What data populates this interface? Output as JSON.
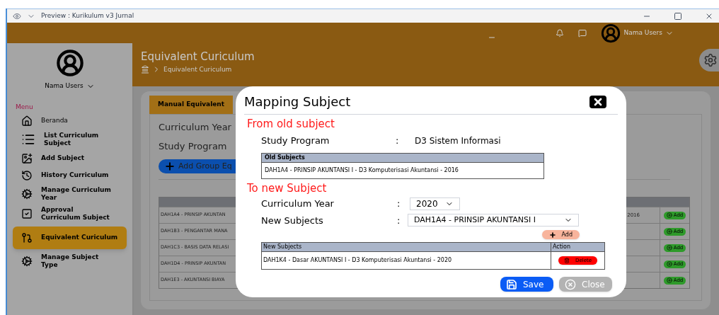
{
  "window": {
    "title": "Preview : Kurikulum v3 Jurnal"
  },
  "topbar": {
    "user_name": "Nama Users"
  },
  "sidebar": {
    "user_name": "Nama Users",
    "menu_label": "Menu",
    "items": [
      {
        "label": "Beranda",
        "selected": false
      },
      {
        "label": "List Curriculum Subject",
        "selected": false
      },
      {
        "label": "Add Subject",
        "selected": false
      },
      {
        "label": "History Curriculum",
        "selected": false
      },
      {
        "label": "Manage Curriculum Year",
        "selected": false
      },
      {
        "label": "Approval Curriculum Subject",
        "selected": false
      },
      {
        "label": "Equivalent Curiculum",
        "selected": true
      },
      {
        "label": "Manage Subject Type",
        "selected": false
      }
    ]
  },
  "page": {
    "title": "Equivalent Curiculum",
    "breadcrumb": "Equivalent Curiculum"
  },
  "panel": {
    "tabs": [
      {
        "label": "Manual Equivalent",
        "selected": true
      }
    ],
    "fields": [
      "Curriculum Year",
      "Study Program"
    ],
    "add_group_button": "Add Group Eq",
    "rows": [
      {
        "column_1": "DAH1A4 - PRINSIP AKUNTAN",
        "column_2": "2016",
        "action": "Add"
      },
      {
        "column_1": "DAH1B3 - PENGANTAR MANA",
        "action": "Add"
      },
      {
        "column_1": "DAH1C3 - BASIS DATA RELASI",
        "action": "Add"
      },
      {
        "column_1": "DAH1D4 - PRINSIP AKUNTAN",
        "action": "Add"
      },
      {
        "column_1": "DAH1E3 - AKUNTANSI BIAYA",
        "action": "Add"
      }
    ]
  },
  "dialog": {
    "title": "Mapping Subject",
    "from_heading": "From old subject",
    "study_program": {
      "label": "Study Program",
      "separator": ":",
      "value": "D3 Sistem Informasi"
    },
    "old_table": {
      "header": "Old Subjects",
      "rows": [
        "DAH1A4 - PRINSIP AKUNTANSI I - D3 Komputerisasi Akuntansi - 2016"
      ]
    },
    "to_heading": "To new Subject",
    "curriculum_year": {
      "label": "Curriculum Year",
      "separator": ":",
      "value": "2020"
    },
    "new_subject": {
      "label": "New Subjects",
      "separator": ":",
      "value": "DAH1A4 - PRINSIP AKUNTANSI I"
    },
    "add_button": "Add",
    "new_table": {
      "columns": [
        "New Subjects",
        "Action"
      ],
      "rows": [
        {
          "subject": "DAH1K4 - Dasar AKUNTANSI I - D3 Komputerisasi Akuntansi - 2020",
          "action": "Delete"
        }
      ]
    },
    "buttons": [
      {
        "label": "Save",
        "kind": "primary"
      },
      {
        "label": "Close",
        "kind": "secondary"
      }
    ]
  }
}
